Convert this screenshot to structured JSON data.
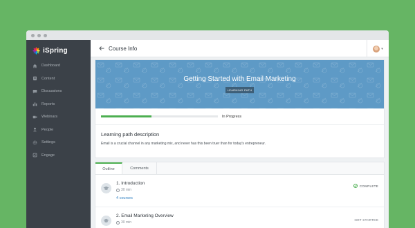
{
  "brand": {
    "name": "iSpring"
  },
  "sidebar": {
    "items": [
      {
        "label": "Dashboard",
        "icon": "home-icon"
      },
      {
        "label": "Content",
        "icon": "content-icon"
      },
      {
        "label": "Discussions",
        "icon": "chat-icon"
      },
      {
        "label": "Reports",
        "icon": "chart-icon"
      },
      {
        "label": "Webinars",
        "icon": "video-icon"
      },
      {
        "label": "People",
        "icon": "person-icon"
      },
      {
        "label": "Settings",
        "icon": "gear-icon"
      },
      {
        "label": "Engage",
        "icon": "engage-icon"
      }
    ]
  },
  "header": {
    "title": "Course Info"
  },
  "course": {
    "title": "Getting Started with Email Marketing",
    "badge": "LEARNING PATH",
    "progress_status": "In Progress",
    "progress_fraction": 0.43
  },
  "description": {
    "title": "Learning path description",
    "text": "Email is a crucial channel in any marketing mix, and never has this been truer than for today's entrepreneur."
  },
  "tabs": [
    {
      "label": "Outline",
      "active": true
    },
    {
      "label": "Comments",
      "active": false
    }
  ],
  "modules": [
    {
      "title": "1. Introduction",
      "duration": "30 min",
      "link": "4 courses",
      "status": "COMPLETE"
    },
    {
      "title": "2. Email Marketing Overview",
      "duration": "30 min",
      "status": "NOT STARTED"
    }
  ],
  "colors": {
    "background": "#66b564",
    "sidebar": "#3b4148",
    "banner": "#5e9ac6",
    "accent": "#4caf50",
    "link": "#2e7fc1"
  }
}
